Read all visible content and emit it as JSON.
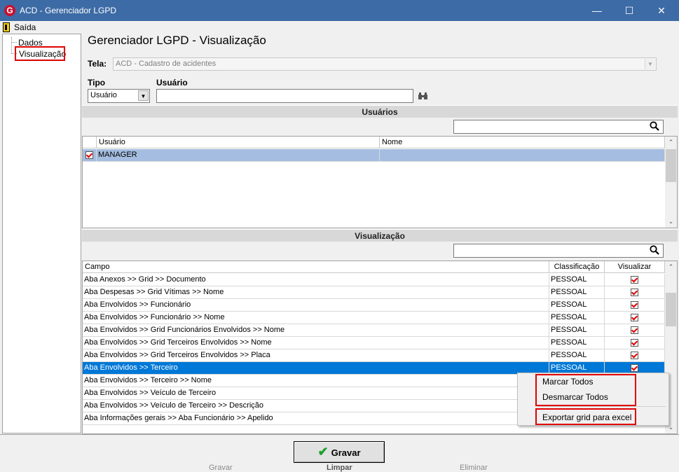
{
  "window": {
    "title": "ACD - Gerenciador LGPD",
    "logo_letter": "G"
  },
  "menu": {
    "exit_label": "Saída"
  },
  "tree": {
    "items": [
      {
        "label": "Dados"
      },
      {
        "label": "Visualização",
        "selected": true
      }
    ]
  },
  "header": {
    "title": "Gerenciador LGPD - Visualização",
    "tela_label": "Tela:",
    "tela_value": "ACD - Cadastro de acidentes",
    "tipo_label": "Tipo",
    "tipo_value": "Usuário",
    "usuario_label": "Usuário",
    "usuario_value": ""
  },
  "usuarios_section": {
    "title": "Usuários",
    "search_value": "",
    "columns": [
      "Usuário",
      "Nome"
    ],
    "rows": [
      {
        "checked": true,
        "usuario": "MANAGER",
        "nome": ""
      }
    ]
  },
  "visualizacao_section": {
    "title": "Visualização",
    "search_value": "",
    "columns": [
      "Campo",
      "Classificação",
      "Visualizar"
    ],
    "rows": [
      {
        "campo": "Aba Anexos >> Grid >> Documento",
        "classificacao": "PESSOAL",
        "visualizar": true
      },
      {
        "campo": "Aba Despesas >> Grid Vítimas >> Nome",
        "classificacao": "PESSOAL",
        "visualizar": true
      },
      {
        "campo": "Aba Envolvidos >> Funcionário",
        "classificacao": "PESSOAL",
        "visualizar": true
      },
      {
        "campo": "Aba Envolvidos >> Funcionário >> Nome",
        "classificacao": "PESSOAL",
        "visualizar": true
      },
      {
        "campo": "Aba Envolvidos >> Grid Funcionários Envolvidos >> Nome",
        "classificacao": "PESSOAL",
        "visualizar": true
      },
      {
        "campo": "Aba Envolvidos >> Grid Terceiros Envolvidos >> Nome",
        "classificacao": "PESSOAL",
        "visualizar": true
      },
      {
        "campo": "Aba Envolvidos >> Grid Terceiros Envolvidos >> Placa",
        "classificacao": "PESSOAL",
        "visualizar": true
      },
      {
        "campo": "Aba Envolvidos >> Terceiro",
        "classificacao": "PESSOAL",
        "visualizar": true,
        "selected": true
      },
      {
        "campo": "Aba Envolvidos >> Terceiro >> Nome",
        "classificacao": "",
        "visualizar": false
      },
      {
        "campo": "Aba Envolvidos >> Veículo de Terceiro",
        "classificacao": "",
        "visualizar": false
      },
      {
        "campo": "Aba Envolvidos >> Veículo de Terceiro >> Descrição",
        "classificacao": "",
        "visualizar": false
      },
      {
        "campo": "Aba Informações gerais >> Aba Funcionário >> Apelido",
        "classificacao": "",
        "visualizar": false
      }
    ]
  },
  "context_menu": {
    "items": [
      "Marcar Todos",
      "Desmarcar Todos",
      "Exportar grid para excel"
    ]
  },
  "footer": {
    "gravar_label": "Gravar",
    "ghost_texts": [
      "Gravar",
      "Limpar",
      "Eliminar"
    ]
  },
  "colors": {
    "titlebar": "#3d6ba5",
    "selection_row": "#0078d7",
    "user_row": "#99b4d1",
    "highlight_red": "#e00000"
  }
}
